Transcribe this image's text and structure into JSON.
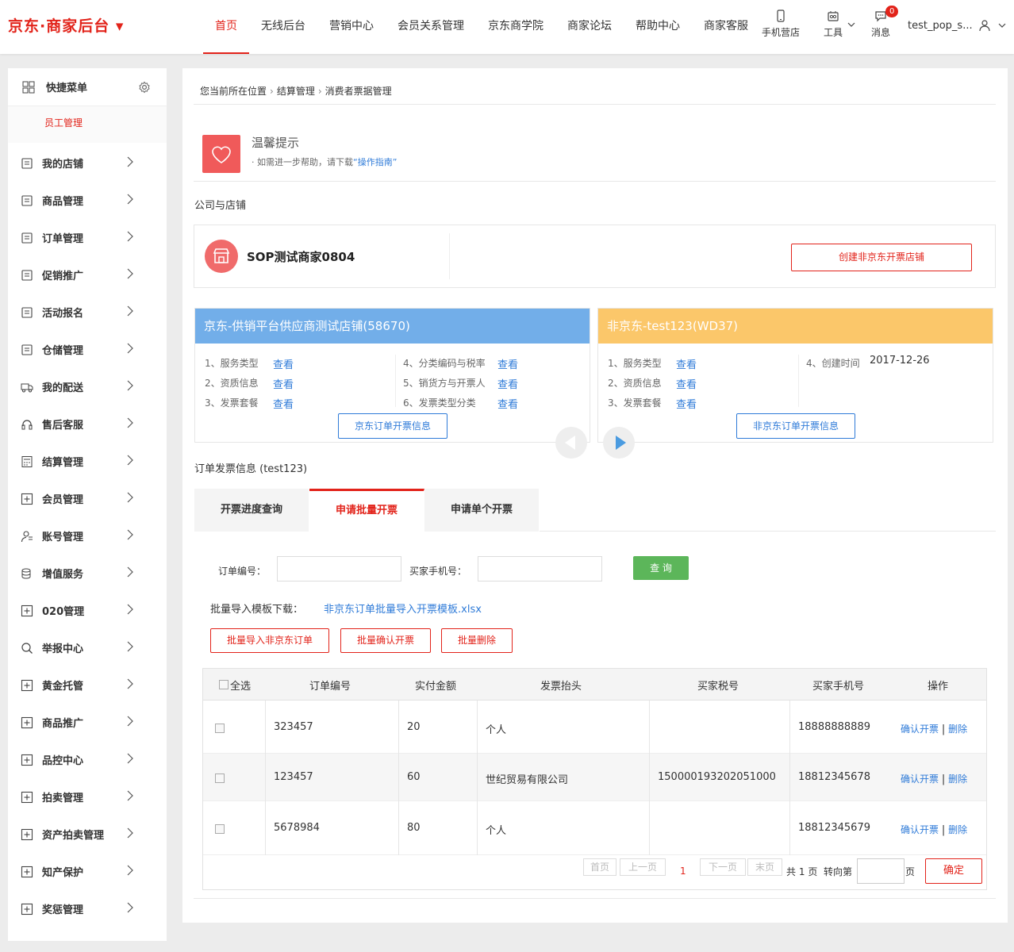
{
  "header": {
    "logo": "京东·商家后台 ▾",
    "nav": [
      "首页",
      "无线后台",
      "营销中心",
      "会员关系管理",
      "京东商学院",
      "商家论坛",
      "帮助中心",
      "商家客服"
    ],
    "tools": {
      "mobile": "手机营店",
      "tools": "工具",
      "messages": "消息",
      "message_count": "0"
    },
    "user": "test_pop_s..."
  },
  "sidebar": {
    "quick_menu": "快捷菜单",
    "quick_item": "员工管理",
    "items": [
      {
        "label": "我的店铺",
        "icon": "store-icon"
      },
      {
        "label": "商品管理",
        "icon": "goods-icon"
      },
      {
        "label": "订单管理",
        "icon": "order-icon"
      },
      {
        "label": "促销推广",
        "icon": "promo-icon"
      },
      {
        "label": "活动报名",
        "icon": "activity-icon"
      },
      {
        "label": "仓储管理",
        "icon": "warehouse-icon"
      },
      {
        "label": "我的配送",
        "icon": "truck-icon"
      },
      {
        "label": "售后客服",
        "icon": "headset-icon"
      },
      {
        "label": "结算管理",
        "icon": "calculator-icon"
      },
      {
        "label": "会员管理",
        "icon": "plus-box-icon"
      },
      {
        "label": "账号管理",
        "icon": "user-icon"
      },
      {
        "label": "增值服务",
        "icon": "coins-icon"
      },
      {
        "label": "020管理",
        "icon": "plus-box-icon"
      },
      {
        "label": "举报中心",
        "icon": "search-icon"
      },
      {
        "label": "黄金托管",
        "icon": "plus-box-icon"
      },
      {
        "label": "商品推广",
        "icon": "plus-box-icon"
      },
      {
        "label": "品控中心",
        "icon": "plus-box-icon"
      },
      {
        "label": "拍卖管理",
        "icon": "plus-box-icon"
      },
      {
        "label": "资产拍卖管理",
        "icon": "plus-box-icon"
      },
      {
        "label": "知产保护",
        "icon": "plus-box-icon"
      },
      {
        "label": "奖惩管理",
        "icon": "plus-box-icon"
      }
    ]
  },
  "breadcrumb": {
    "root": "您当前所在位置",
    "level1": "结算管理",
    "level2": "消费者票据管理"
  },
  "tip": {
    "title": "温馨提示",
    "text": "· 如需进一步帮助，请下载",
    "link": "“操作指南”"
  },
  "company": {
    "section": "公司与店铺",
    "name": "SOP测试商家0804",
    "create_button": "创建非京东开票店铺"
  },
  "card_jd": {
    "title": "京东-供销平台供应商测试店铺(58670)",
    "color": "#72aee9",
    "rows": [
      {
        "label": "1、服务类型",
        "link": "查看"
      },
      {
        "label": "2、资质信息",
        "link": "查看"
      },
      {
        "label": "3、发票套餐",
        "link": "查看"
      },
      {
        "label": "4、分类编码与税率",
        "link": "查看"
      },
      {
        "label": "5、销货方与开票人",
        "link": "查看"
      },
      {
        "label": "6、发票类型分类",
        "link": "查看"
      }
    ],
    "button": "京东订单开票信息"
  },
  "card_nonjd": {
    "title": "非京东-test123(WD37)",
    "color": "#fbc76a",
    "rows": [
      {
        "label": "1、服务类型",
        "link": "查看"
      },
      {
        "label": "2、资质信息",
        "link": "查看"
      },
      {
        "label": "3、发票套餐",
        "link": "查看"
      }
    ],
    "created_label": "4、创建时间",
    "created_value": "2017-12-26",
    "button": "非京东订单开票信息"
  },
  "invoice": {
    "section": "订单发票信息 (test123)",
    "tabs": [
      "开票进度查询",
      "申请批量开票",
      "申请单个开票"
    ],
    "active_tab": 1,
    "order_label": "订单编号：",
    "phone_label": "买家手机号：",
    "query_button": "查 询",
    "template_label": "批量导入模板下载：",
    "template_link": "非京东订单批量导入开票模板.xlsx",
    "buttons": [
      "批量导入非京东订单",
      "批量确认开票",
      "批量删除"
    ],
    "table": {
      "headers": [
        "全选",
        "订单编号",
        "实付金额",
        "发票抬头",
        "买家税号",
        "买家手机号",
        "操作"
      ],
      "rows": [
        {
          "order": "323457",
          "amount": "20",
          "title": "个人",
          "tax": "",
          "phone": "18888888889"
        },
        {
          "order": "123457",
          "amount": "60",
          "title": "世纪贸易有限公司",
          "tax": "150000193202051000",
          "phone": "18812345678"
        },
        {
          "order": "5678984",
          "amount": "80",
          "title": "个人",
          "tax": "",
          "phone": "18812345679"
        }
      ],
      "op_confirm": "确认开票",
      "op_sep": "|",
      "op_delete": "删除"
    },
    "pagination": {
      "first": "首页",
      "prev": "上一页",
      "current": "1",
      "next": "下一页",
      "last": "末页",
      "total_prefix": "共",
      "total": "1",
      "total_suffix": "页",
      "goto": "转向第",
      "page_unit": "页",
      "confirm": "确定"
    }
  }
}
